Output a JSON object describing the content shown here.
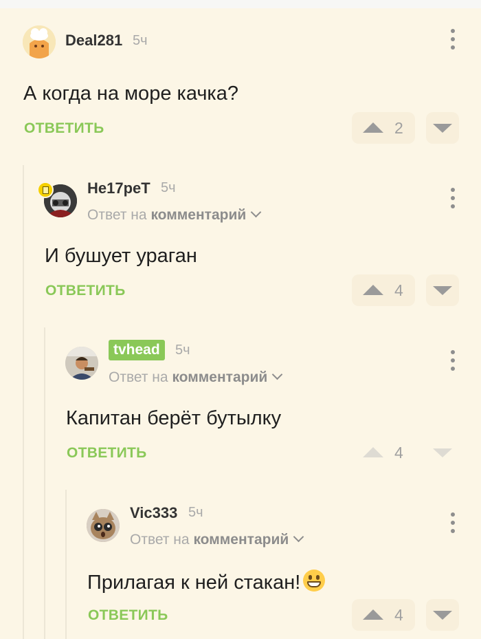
{
  "comments": [
    {
      "username": "Deal281",
      "time": "5ч",
      "reply_to_prefix": "",
      "reply_to_link": "",
      "text": "А когда на море качка?",
      "reply": "ОТВЕТИТЬ",
      "score": "2"
    },
    {
      "username": "He17peT",
      "time": "5ч",
      "reply_to_prefix": "Ответ на",
      "reply_to_link": "комментарий",
      "text": "И бушует ураган",
      "reply": "ОТВЕТИТЬ",
      "score": "4"
    },
    {
      "username": "tvhead",
      "time": "5ч",
      "reply_to_prefix": "Ответ на",
      "reply_to_link": "комментарий",
      "text": "Капитан берёт бутылку",
      "reply": "ОТВЕТИТЬ",
      "score": "4"
    },
    {
      "username": "Vic333",
      "time": "5ч",
      "reply_to_prefix": "Ответ на",
      "reply_to_link": "комментарий",
      "text": "Прилагая к ней стакан!",
      "reply": "ОТВЕТИТЬ",
      "score": "4"
    }
  ],
  "icons": {
    "menu": "more-vertical-icon",
    "upvote": "upvote-arrow-icon",
    "downvote": "downvote-arrow-icon",
    "chevron": "chevron-down-icon",
    "emoji": "grinning-face-icon",
    "badge": "author-badge-icon"
  },
  "colors": {
    "background": "#fcf6e6",
    "accent": "#8ac858",
    "muted": "#a9a9a9",
    "vote_box": "#f8efdb"
  }
}
